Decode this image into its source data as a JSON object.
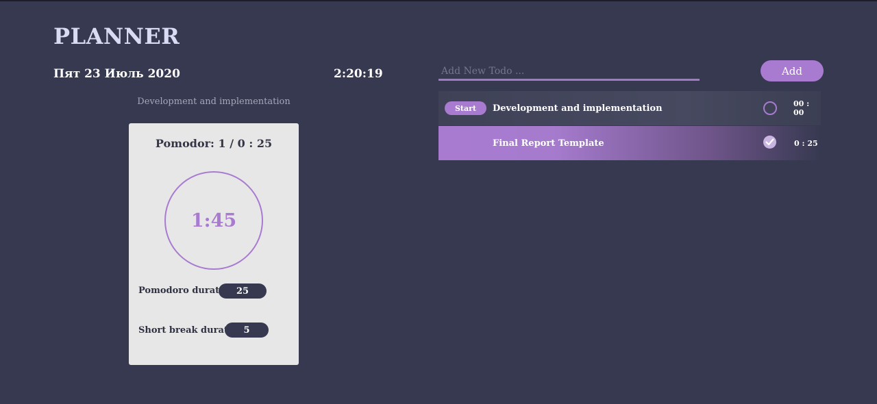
{
  "app": {
    "title": "PLANNER"
  },
  "header": {
    "date": "Пят 23 Июль 2020",
    "clock": "2:20:19"
  },
  "current_task": "Development and implementation",
  "pomodoro": {
    "status": "Pomodor: 1 / 0 : 25",
    "timer": "1:45",
    "pomodoro_duration_label": "Pomodoro duration:",
    "pomodoro_duration": "25",
    "short_break_label": "Short break duration:",
    "short_break": "5"
  },
  "todo_input": {
    "placeholder": "Add New Todo ..."
  },
  "add_button": {
    "label": "Add"
  },
  "todos": [
    {
      "start_label": "Start",
      "text": "Development and implementation",
      "time": "00 : 00",
      "done": false
    },
    {
      "text": "Final Report Template",
      "time": "0 : 25",
      "done": true
    }
  ],
  "colors": {
    "background": "#363950",
    "accent": "#a87bd0",
    "card": "#e7e7e7",
    "title": "#d9daf3"
  },
  "icons": {
    "unchecked": "circle-outline-icon",
    "checked": "check-circle-icon"
  }
}
